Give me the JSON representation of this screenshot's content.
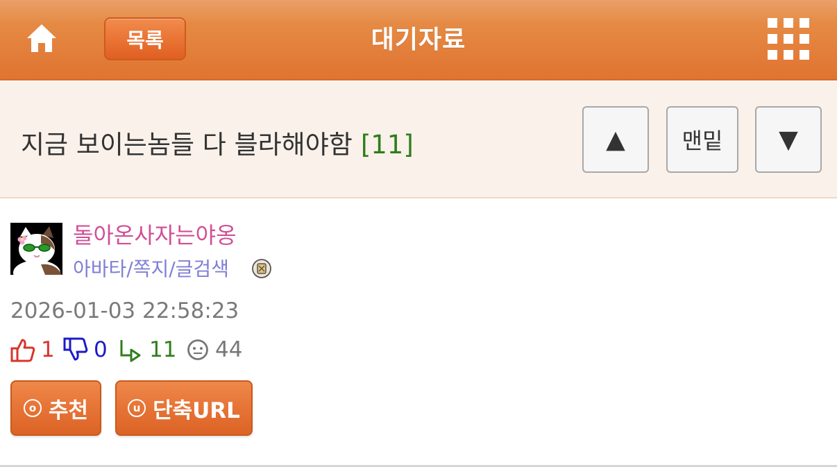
{
  "header": {
    "home_icon": "home-icon",
    "list_button_label": "목록",
    "title": "대기자료",
    "menu_icon": "grid-menu-icon",
    "accent_color": "#e07431"
  },
  "post": {
    "subject": "지금 보이는놈들 다 블라해야함",
    "comment_count": "[11]",
    "nav": {
      "up_label": "▲",
      "bottom_label": "맨밑",
      "down_label": "▼"
    }
  },
  "author": {
    "name": "돌아온사자는야옹",
    "links": "아바타/쪽지/글검색",
    "avatar_icon": "cat-avatar-icon",
    "badge_icon": "level-badge-icon"
  },
  "meta": {
    "date": "2026-01-03 22:58:23",
    "upvotes": "1",
    "downvotes": "0",
    "comments": "11",
    "views": "44",
    "upvote_color": "#d9342b",
    "downvote_color": "#1a1acc",
    "comment_color": "#2f7d1c",
    "views_color": "#777777"
  },
  "actions": {
    "recommend_icon": "ⓞ",
    "recommend_label": "추천",
    "shorturl_icon": "ⓤ",
    "shorturl_label": "단축URL"
  }
}
